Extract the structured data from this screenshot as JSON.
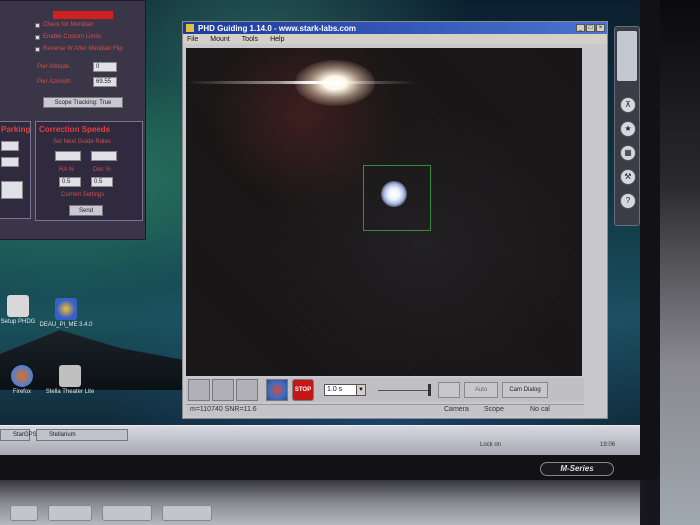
{
  "scope_panel": {
    "checkboxes": [
      "Check for Meridian",
      "Enable Custom Limits",
      "Reverse W After Meridian Flip"
    ],
    "fields": [
      {
        "label": "Pier Altitude",
        "value": "0"
      },
      {
        "label": "Pier Azimuth",
        "value": "69.55"
      }
    ],
    "tracking_button": "Scope Tracking: True",
    "correction_title": "Correction Speeds",
    "correction_sub": "Set Next Guide Rates",
    "ra_label": "RA %",
    "dec_label": "Dec %",
    "ra_value": "0.5",
    "dec_value": "0.5",
    "current_settings": "Current Settings",
    "send_button": "Send",
    "left_title": "Parking"
  },
  "desktop_icons": [
    {
      "label": "Setup PHDG",
      "color": "#d8d8d8"
    },
    {
      "label": "DEAU_PI_ME 3.4.0",
      "color": "#3a5fc8"
    },
    {
      "label": "Firefox",
      "color": "#5080d0"
    },
    {
      "label": "Stella Theater Lite",
      "color": "#c0c0c0"
    }
  ],
  "phd": {
    "title": "PHD Guiding 1.14.0  -  www.stark-labs.com",
    "menu": [
      "File",
      "Mount",
      "Tools",
      "Help"
    ],
    "extra_menu": "Mount",
    "exposure": "1.0 s",
    "stop_label": "STOP",
    "auto_label": "Auto",
    "cam_dialog": "Cam Dialog",
    "status_left": "m=110740 SNR=11.6",
    "status_camera": "Camera",
    "status_scope": "Scope",
    "status_cal": "No cal"
  },
  "taskbar": {
    "items": [
      "StarGPS",
      "Stellarium"
    ],
    "tray_left": "Lock on",
    "tray_time": "19:06"
  },
  "laptop": {
    "badge": "M-Series"
  }
}
